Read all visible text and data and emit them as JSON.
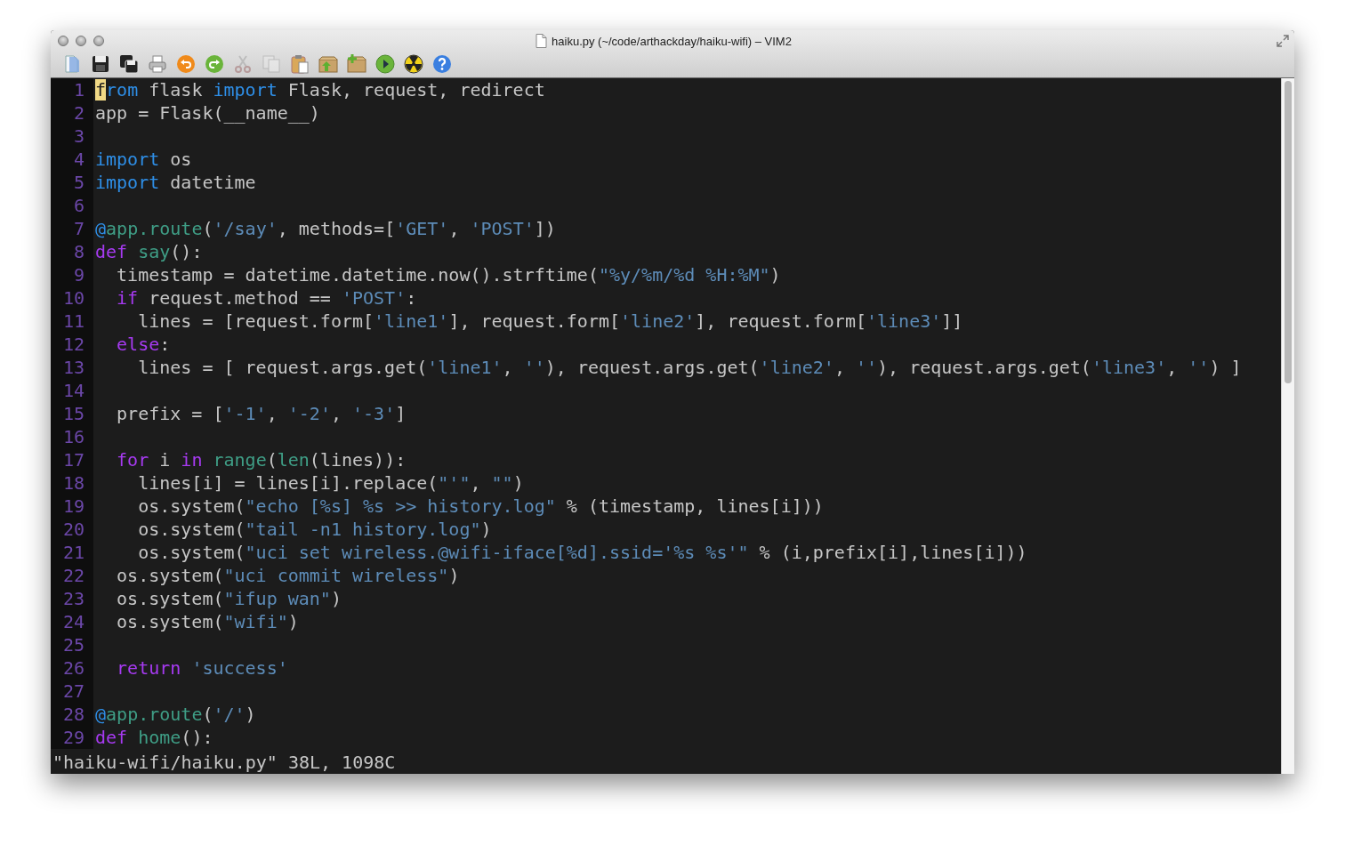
{
  "window": {
    "title": "haiku.py (~/code/arthackday/haiku-wifi) – VIM2"
  },
  "toolbar": [
    {
      "kind": "open",
      "disabled": false
    },
    {
      "kind": "save",
      "disabled": false
    },
    {
      "kind": "save-all",
      "disabled": false
    },
    {
      "kind": "print",
      "disabled": false
    },
    {
      "kind": "undo",
      "disabled": false
    },
    {
      "kind": "redo",
      "disabled": false
    },
    {
      "kind": "cut",
      "disabled": true
    },
    {
      "kind": "copy",
      "disabled": true
    },
    {
      "kind": "paste",
      "disabled": false
    },
    {
      "kind": "load-session",
      "disabled": false
    },
    {
      "kind": "save-session",
      "disabled": false
    },
    {
      "kind": "run",
      "disabled": false
    },
    {
      "kind": "radiation",
      "disabled": false
    },
    {
      "kind": "help",
      "disabled": false
    }
  ],
  "editor": {
    "lines": [
      {
        "number": "1",
        "tokens": [
          {
            "kind": "cursor",
            "text": "f"
          },
          {
            "kind": "import",
            "text": "rom"
          },
          {
            "kind": "plain",
            "text": " flask "
          },
          {
            "kind": "import",
            "text": "import"
          },
          {
            "kind": "plain",
            "text": " Flask, request, redirect"
          }
        ]
      },
      {
        "number": "2",
        "tokens": [
          {
            "kind": "plain",
            "text": "app = Flask(__name__)"
          }
        ]
      },
      {
        "number": "3"
      },
      {
        "number": "4",
        "tokens": [
          {
            "kind": "import",
            "text": "import"
          },
          {
            "kind": "plain",
            "text": " os"
          }
        ]
      },
      {
        "number": "5",
        "tokens": [
          {
            "kind": "import",
            "text": "import"
          },
          {
            "kind": "plain",
            "text": " datetime"
          }
        ]
      },
      {
        "number": "6"
      },
      {
        "number": "7",
        "tokens": [
          {
            "kind": "import",
            "text": "@"
          },
          {
            "kind": "func",
            "text": "app.route"
          },
          {
            "kind": "plain",
            "text": "("
          },
          {
            "kind": "string",
            "text": "'/say'"
          },
          {
            "kind": "plain",
            "text": ", methods=["
          },
          {
            "kind": "string",
            "text": "'GET'"
          },
          {
            "kind": "plain",
            "text": ", "
          },
          {
            "kind": "string",
            "text": "'POST'"
          },
          {
            "kind": "plain",
            "text": "])"
          }
        ]
      },
      {
        "number": "8",
        "tokens": [
          {
            "kind": "keyword",
            "text": "def "
          },
          {
            "kind": "func",
            "text": "say"
          },
          {
            "kind": "plain",
            "text": "():"
          }
        ]
      },
      {
        "number": "9",
        "tokens": [
          {
            "kind": "plain",
            "text": "  timestamp = datetime.datetime.now().strftime("
          },
          {
            "kind": "string",
            "text": "\"%y/%m/%d %H:%M\""
          },
          {
            "kind": "plain",
            "text": ")"
          }
        ]
      },
      {
        "number": "10",
        "tokens": [
          {
            "kind": "keyword",
            "text": "  if"
          },
          {
            "kind": "plain",
            "text": " request.method == "
          },
          {
            "kind": "string",
            "text": "'POST'"
          },
          {
            "kind": "plain",
            "text": ":"
          }
        ]
      },
      {
        "number": "11",
        "tokens": [
          {
            "kind": "plain",
            "text": "    lines = [request.form["
          },
          {
            "kind": "string",
            "text": "'line1'"
          },
          {
            "kind": "plain",
            "text": "], request.form["
          },
          {
            "kind": "string",
            "text": "'line2'"
          },
          {
            "kind": "plain",
            "text": "], request.form["
          },
          {
            "kind": "string",
            "text": "'line3'"
          },
          {
            "kind": "plain",
            "text": "]]"
          }
        ]
      },
      {
        "number": "12",
        "tokens": [
          {
            "kind": "keyword",
            "text": "  else"
          },
          {
            "kind": "plain",
            "text": ":"
          }
        ]
      },
      {
        "number": "13",
        "tokens": [
          {
            "kind": "plain",
            "text": "    lines = [ request.args.get("
          },
          {
            "kind": "string",
            "text": "'line1'"
          },
          {
            "kind": "plain",
            "text": ", "
          },
          {
            "kind": "string",
            "text": "''"
          },
          {
            "kind": "plain",
            "text": "), request.args.get("
          },
          {
            "kind": "string",
            "text": "'line2'"
          },
          {
            "kind": "plain",
            "text": ", "
          },
          {
            "kind": "string",
            "text": "''"
          },
          {
            "kind": "plain",
            "text": "), request.args.get("
          },
          {
            "kind": "string",
            "text": "'line3'"
          },
          {
            "kind": "plain",
            "text": ", "
          },
          {
            "kind": "string",
            "text": "''"
          },
          {
            "kind": "plain",
            "text": ") ]"
          }
        ]
      },
      {
        "number": "14"
      },
      {
        "number": "15",
        "tokens": [
          {
            "kind": "plain",
            "text": "  prefix = ["
          },
          {
            "kind": "string",
            "text": "'-1'"
          },
          {
            "kind": "plain",
            "text": ", "
          },
          {
            "kind": "string",
            "text": "'-2'"
          },
          {
            "kind": "plain",
            "text": ", "
          },
          {
            "kind": "string",
            "text": "'-3'"
          },
          {
            "kind": "plain",
            "text": "]"
          }
        ]
      },
      {
        "number": "16"
      },
      {
        "number": "17",
        "tokens": [
          {
            "kind": "keyword",
            "text": "  for"
          },
          {
            "kind": "plain",
            "text": " i "
          },
          {
            "kind": "keyword",
            "text": "in "
          },
          {
            "kind": "func",
            "text": "range"
          },
          {
            "kind": "plain",
            "text": "("
          },
          {
            "kind": "func",
            "text": "len"
          },
          {
            "kind": "plain",
            "text": "(lines)):"
          }
        ]
      },
      {
        "number": "18",
        "tokens": [
          {
            "kind": "plain",
            "text": "    lines[i] = lines[i].replace("
          },
          {
            "kind": "string",
            "text": "\"'\""
          },
          {
            "kind": "plain",
            "text": ", "
          },
          {
            "kind": "string",
            "text": "\"\""
          },
          {
            "kind": "plain",
            "text": ")"
          }
        ]
      },
      {
        "number": "19",
        "tokens": [
          {
            "kind": "plain",
            "text": "    os.system("
          },
          {
            "kind": "string",
            "text": "\"echo [%s] %s >> history.log\""
          },
          {
            "kind": "plain",
            "text": " % (timestamp, lines[i]))"
          }
        ]
      },
      {
        "number": "20",
        "tokens": [
          {
            "kind": "plain",
            "text": "    os.system("
          },
          {
            "kind": "string",
            "text": "\"tail -n1 history.log\""
          },
          {
            "kind": "plain",
            "text": ")"
          }
        ]
      },
      {
        "number": "21",
        "tokens": [
          {
            "kind": "plain",
            "text": "    os.system("
          },
          {
            "kind": "string",
            "text": "\"uci set wireless.@wifi-iface[%d].ssid='%s %s'\""
          },
          {
            "kind": "plain",
            "text": " % (i,prefix[i],lines[i]))"
          }
        ]
      },
      {
        "number": "22",
        "tokens": [
          {
            "kind": "plain",
            "text": "  os.system("
          },
          {
            "kind": "string",
            "text": "\"uci commit wireless\""
          },
          {
            "kind": "plain",
            "text": ")"
          }
        ]
      },
      {
        "number": "23",
        "tokens": [
          {
            "kind": "plain",
            "text": "  os.system("
          },
          {
            "kind": "string",
            "text": "\"ifup wan\""
          },
          {
            "kind": "plain",
            "text": ")"
          }
        ]
      },
      {
        "number": "24",
        "tokens": [
          {
            "kind": "plain",
            "text": "  os.system("
          },
          {
            "kind": "string",
            "text": "\"wifi\""
          },
          {
            "kind": "plain",
            "text": ")"
          }
        ]
      },
      {
        "number": "25"
      },
      {
        "number": "26",
        "tokens": [
          {
            "kind": "keyword",
            "text": "  return "
          },
          {
            "kind": "string",
            "text": "'success'"
          }
        ]
      },
      {
        "number": "27"
      },
      {
        "number": "28",
        "tokens": [
          {
            "kind": "import",
            "text": "@"
          },
          {
            "kind": "func",
            "text": "app.route"
          },
          {
            "kind": "plain",
            "text": "("
          },
          {
            "kind": "string",
            "text": "'/'"
          },
          {
            "kind": "plain",
            "text": ")"
          }
        ]
      },
      {
        "number": "29",
        "tokens": [
          {
            "kind": "keyword",
            "text": "def "
          },
          {
            "kind": "func",
            "text": "home"
          },
          {
            "kind": "plain",
            "text": "():"
          }
        ]
      }
    ]
  },
  "status_line": "\"haiku-wifi/haiku.py\" 38L, 1098C"
}
